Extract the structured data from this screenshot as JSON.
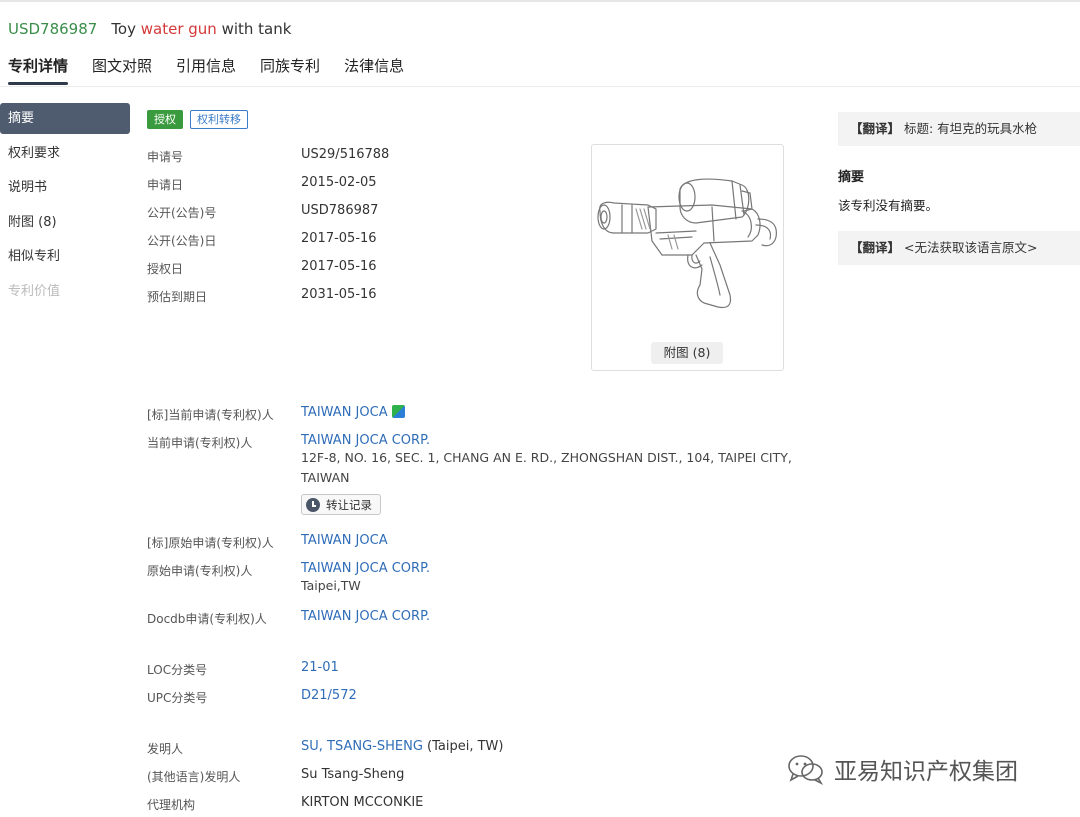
{
  "header": {
    "patent_number": "USD786987",
    "title_part1": "Toy ",
    "title_part2": "water gun",
    "title_part3": " with tank"
  },
  "tabs": [
    "专利详情",
    "图文对照",
    "引用信息",
    "同族专利",
    "法律信息"
  ],
  "sidebar": [
    "摘要",
    "权利要求",
    "说明书",
    "附图 (8)",
    "相似专利",
    "专利价值"
  ],
  "badges": {
    "granted": "授权",
    "transfer": "权利转移"
  },
  "basic": {
    "app_no_label": "申请号",
    "app_no": "US29/516788",
    "app_date_label": "申请日",
    "app_date": "2015-02-05",
    "pub_no_label": "公开(公告)号",
    "pub_no": "USD786987",
    "pub_date_label": "公开(公告)日",
    "pub_date": "2017-05-16",
    "grant_date_label": "授权日",
    "grant_date": "2017-05-16",
    "expiry_label": "预估到期日",
    "expiry": "2031-05-16"
  },
  "figure": {
    "button": "附图 (8)"
  },
  "applicants": {
    "std_current_label": "[标]当前申请(专利权)人",
    "std_current": "TAIWAN JOCA",
    "current_label": "当前申请(专利权)人",
    "current": "TAIWAN JOCA CORP.",
    "current_addr1": "12F-8, NO. 16, SEC. 1, CHANG AN E. RD., ZHONGSHAN DIST., 104, TAIPEI CITY,",
    "current_addr2": "TAIWAN",
    "transfer_btn": "转让记录",
    "std_original_label": "[标]原始申请(专利权)人",
    "std_original": "TAIWAN JOCA",
    "original_label": "原始申请(专利权)人",
    "original": "TAIWAN JOCA CORP.",
    "original_loc": "Taipei,TW",
    "docdb_label": "Docdb申请(专利权)人",
    "docdb": "TAIWAN JOCA CORP."
  },
  "classification": {
    "loc_label": "LOC分类号",
    "loc": "21-01",
    "upc_label": "UPC分类号",
    "upc": "D21/572"
  },
  "people": {
    "inventor_label": "发明人",
    "inventor": "SU, TSANG-SHENG",
    "inventor_loc": " (Taipei, TW)",
    "other_inventor_label": "(其他语言)发明人",
    "other_inventor": "Su Tsang-Sheng",
    "agency_label": "代理机构",
    "agency": "KIRTON MCCONKIE"
  },
  "right_panel": {
    "trans1_tag": "【翻译】",
    "trans1_text": " 标题: 有坦克的玩具水枪",
    "abstract_title": "摘要",
    "abstract_text": "该专利没有摘要。",
    "trans2_tag": "【翻译】",
    "trans2_text": " <无法获取该语言原文>"
  },
  "watermark": "亚易知识产权集团"
}
